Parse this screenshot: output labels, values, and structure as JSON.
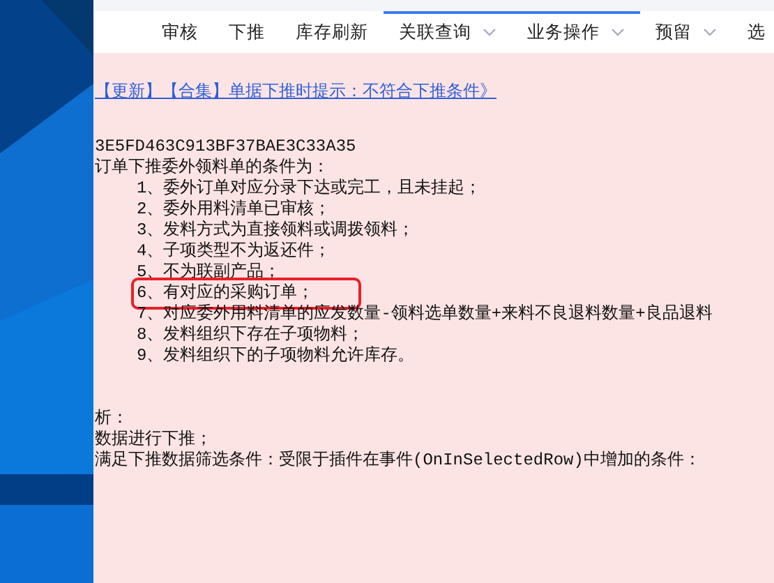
{
  "toolbar": {
    "items": [
      {
        "label": "审核",
        "dropdown": false,
        "selected": false
      },
      {
        "label": "下推",
        "dropdown": false,
        "selected": false
      },
      {
        "label": "库存刷新",
        "dropdown": false,
        "selected": false
      },
      {
        "label": "关联查询",
        "dropdown": true,
        "selected": true
      },
      {
        "label": "业务操作",
        "dropdown": true,
        "selected": true
      },
      {
        "label": "预留",
        "dropdown": true,
        "selected": false
      },
      {
        "label": "选",
        "selected": false
      }
    ]
  },
  "content": {
    "link": "【更新】【合集】单据下推时提示：不符合下推条件》",
    "code": "3E5FD463C913BF37BAE3C33A35",
    "heading": "订单下推委外领料单的条件为：",
    "conditions": [
      {
        "text": "1、委外订单对应分录下达或完工，且未挂起；",
        "highlighted": false
      },
      {
        "text": "2、委外用料清单已审核；",
        "highlighted": false
      },
      {
        "text": "3、发料方式为直接领料或调拨领料；",
        "highlighted": false
      },
      {
        "text": "4、子项类型不为返还件；",
        "highlighted": false
      },
      {
        "text": "5、不为联副产品；",
        "highlighted": false
      },
      {
        "text": "6、有对应的采购订单；",
        "highlighted": true
      },
      {
        "text": "7、对应委外用料清单的应发数量-领料选单数量+来料不良退料数量+良品退料",
        "highlighted": false
      },
      {
        "text": "8、发料组织下存在子项物料；",
        "highlighted": false
      },
      {
        "text": "9、发料组织下的子项物料允许库存。",
        "highlighted": false
      }
    ],
    "notes": [
      "析：",
      "数据进行下推；",
      "满足下推数据筛选条件：受限于插件在事件(OnInSelectedRow)中增加的条件："
    ]
  }
}
